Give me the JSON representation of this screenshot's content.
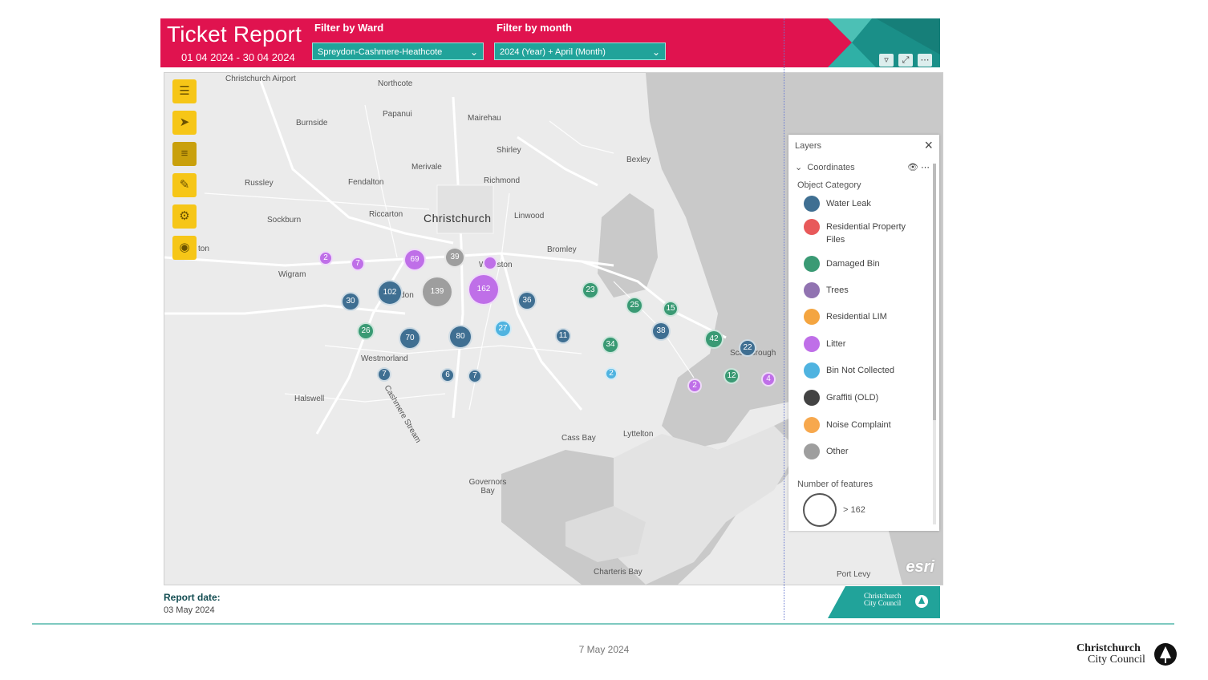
{
  "report": {
    "title": "Ticket Report",
    "date_range": "01 04 2024 - 30 04 2024",
    "filter_ward_label": "Filter by Ward",
    "filter_ward_value": "Spreydon-Cashmere-Heathcote",
    "filter_month_label": "Filter by month",
    "filter_month_value": "2024 (Year) + April (Month)",
    "header_icons": [
      "filter-icon",
      "expand-icon",
      "more-icon"
    ],
    "colors": {
      "header": "#e0134f",
      "teal": "#21a39a",
      "toolbar": "#f6c617"
    }
  },
  "map": {
    "places": [
      {
        "label": "Christchurch Airport"
      },
      {
        "label": "Northcote"
      },
      {
        "label": "Burnside"
      },
      {
        "label": "Papanui"
      },
      {
        "label": "Mairehau"
      },
      {
        "label": "Shirley"
      },
      {
        "label": "Merivale"
      },
      {
        "label": "Bexley"
      },
      {
        "label": "Russley"
      },
      {
        "label": "Fendalton"
      },
      {
        "label": "Richmond"
      },
      {
        "label": "Sockburn"
      },
      {
        "label": "Riccarton"
      },
      {
        "label": "Christchurch"
      },
      {
        "label": "Linwood"
      },
      {
        "label": "Bromley"
      },
      {
        "label": "Wigram"
      },
      {
        "label": "Westmorland"
      },
      {
        "label": "Halswell"
      },
      {
        "label": "Cashmere Stream"
      },
      {
        "label": "Cass Bay"
      },
      {
        "label": "Lyttelton"
      },
      {
        "label": "Governors Bay"
      },
      {
        "label": "Charteris Bay"
      },
      {
        "label": "Port Levy"
      },
      {
        "label": "Scarborough"
      },
      {
        "label": "ton"
      },
      {
        "label": "Woolston"
      },
      {
        "label": "Spreydon"
      }
    ],
    "clusters": [
      {
        "count": "2",
        "category": "Litter"
      },
      {
        "count": "7",
        "category": "Litter"
      },
      {
        "count": "69",
        "category": "Litter"
      },
      {
        "count": "39",
        "category": "Other"
      },
      {
        "count": "",
        "category": "Litter"
      },
      {
        "count": "30",
        "category": "Water Leak"
      },
      {
        "count": "102",
        "category": "Water Leak"
      },
      {
        "count": "139",
        "category": "Other"
      },
      {
        "count": "162",
        "category": "Litter"
      },
      {
        "count": "36",
        "category": "Water Leak"
      },
      {
        "count": "23",
        "category": "Damaged Bin"
      },
      {
        "count": "25",
        "category": "Damaged Bin"
      },
      {
        "count": "15",
        "category": "Damaged Bin"
      },
      {
        "count": "26",
        "category": "Damaged Bin"
      },
      {
        "count": "70",
        "category": "Water Leak"
      },
      {
        "count": "80",
        "category": "Water Leak"
      },
      {
        "count": "27",
        "category": "Bin Not Collected"
      },
      {
        "count": "11",
        "category": "Water Leak"
      },
      {
        "count": "34",
        "category": "Damaged Bin"
      },
      {
        "count": "38",
        "category": "Water Leak"
      },
      {
        "count": "42",
        "category": "Damaged Bin"
      },
      {
        "count": "22",
        "category": "Water Leak"
      },
      {
        "count": "7",
        "category": "Water Leak"
      },
      {
        "count": "6",
        "category": "Water Leak"
      },
      {
        "count": "7",
        "category": "Water Leak"
      },
      {
        "count": "2",
        "category": "Bin Not Collected"
      },
      {
        "count": "2",
        "category": "Litter"
      },
      {
        "count": "12",
        "category": "Damaged Bin"
      },
      {
        "count": "4",
        "category": "Litter"
      }
    ],
    "esri": "esri",
    "toolbar": [
      "menu-icon",
      "pointer-icon",
      "layer-list-icon",
      "pencil-icon",
      "gear-icon",
      "user-icon"
    ]
  },
  "layers": {
    "title": "Layers",
    "layer_name": "Coordinates",
    "object_category_label": "Object Category",
    "categories": [
      {
        "name": "Water Leak",
        "color": "#3f6f92"
      },
      {
        "name": "Residential Property Files",
        "color": "#e8595a"
      },
      {
        "name": "Damaged Bin",
        "color": "#3a9a74"
      },
      {
        "name": "Trees",
        "color": "#9173b1"
      },
      {
        "name": "Residential LIM",
        "color": "#f4a540"
      },
      {
        "name": "Litter",
        "color": "#bf6fe8"
      },
      {
        "name": "Bin Not Collected",
        "color": "#4fb3e0"
      },
      {
        "name": "Graffiti (OLD)",
        "color": "#434343"
      },
      {
        "name": "Noise Complaint",
        "color": "#f7a84d"
      },
      {
        "name": "Other",
        "color": "#9e9e9e"
      }
    ],
    "number_of_features_label": "Number of features",
    "features_threshold": "> 162"
  },
  "footer": {
    "report_date_label": "Report date:",
    "report_date": "03 May 2024",
    "logo_line1": "Christchurch",
    "logo_line2": "City Council",
    "slide_date": "7 May 2024",
    "brand_line1": "Christchurch",
    "brand_line2": "City Council"
  }
}
